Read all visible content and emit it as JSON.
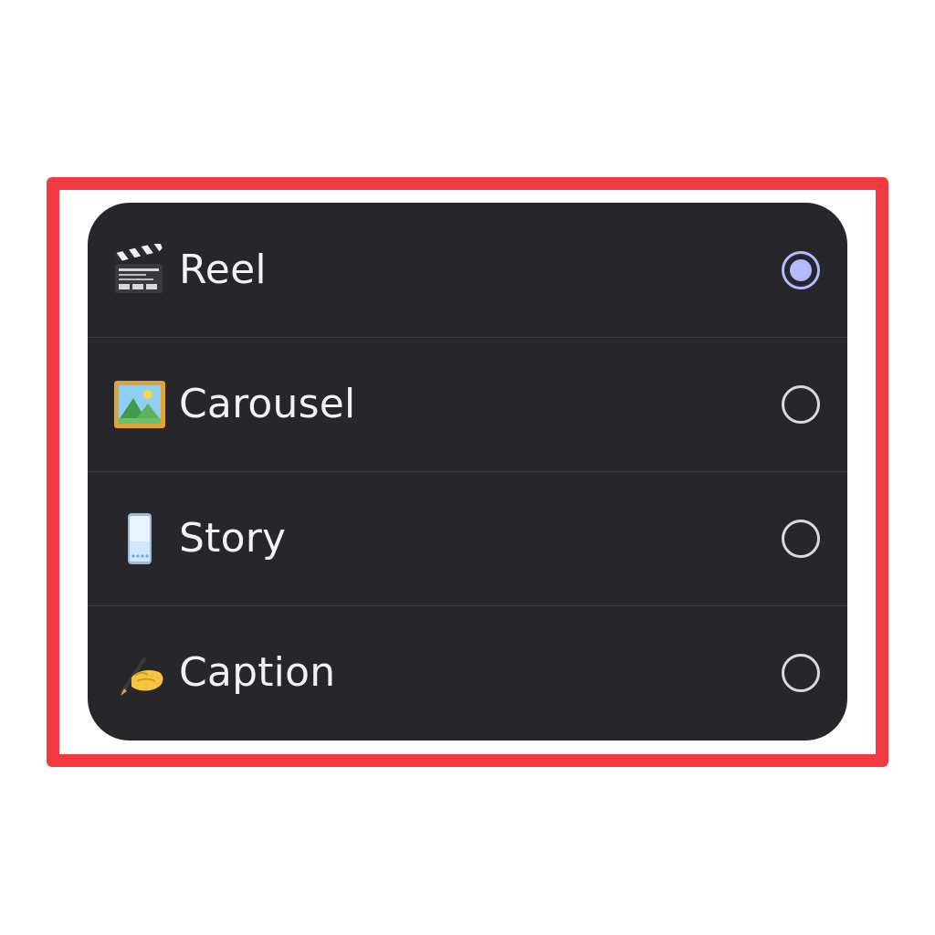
{
  "highlight_color": "#f23b40",
  "panel": {
    "background": "#26262b",
    "accent": "#b3baff"
  },
  "options": [
    {
      "icon": "clapper-board-icon",
      "label": "Reel",
      "selected": true
    },
    {
      "icon": "framed-picture-icon",
      "label": "Carousel",
      "selected": false
    },
    {
      "icon": "mobile-phone-icon",
      "label": "Story",
      "selected": false
    },
    {
      "icon": "writing-hand-icon",
      "label": "Caption",
      "selected": false
    }
  ]
}
